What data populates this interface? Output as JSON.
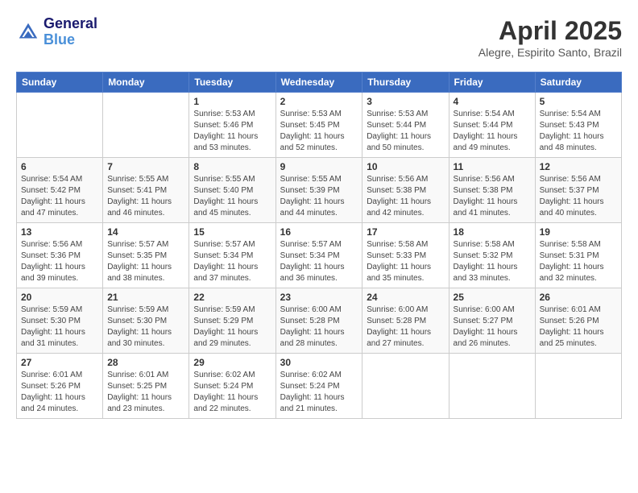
{
  "header": {
    "logo_general": "General",
    "logo_blue": "Blue",
    "month_year": "April 2025",
    "location": "Alegre, Espirito Santo, Brazil"
  },
  "columns": [
    "Sunday",
    "Monday",
    "Tuesday",
    "Wednesday",
    "Thursday",
    "Friday",
    "Saturday"
  ],
  "weeks": [
    {
      "days": [
        {
          "num": "",
          "info": ""
        },
        {
          "num": "",
          "info": ""
        },
        {
          "num": "1",
          "info": "Sunrise: 5:53 AM\nSunset: 5:46 PM\nDaylight: 11 hours\nand 53 minutes."
        },
        {
          "num": "2",
          "info": "Sunrise: 5:53 AM\nSunset: 5:45 PM\nDaylight: 11 hours\nand 52 minutes."
        },
        {
          "num": "3",
          "info": "Sunrise: 5:53 AM\nSunset: 5:44 PM\nDaylight: 11 hours\nand 50 minutes."
        },
        {
          "num": "4",
          "info": "Sunrise: 5:54 AM\nSunset: 5:44 PM\nDaylight: 11 hours\nand 49 minutes."
        },
        {
          "num": "5",
          "info": "Sunrise: 5:54 AM\nSunset: 5:43 PM\nDaylight: 11 hours\nand 48 minutes."
        }
      ]
    },
    {
      "days": [
        {
          "num": "6",
          "info": "Sunrise: 5:54 AM\nSunset: 5:42 PM\nDaylight: 11 hours\nand 47 minutes."
        },
        {
          "num": "7",
          "info": "Sunrise: 5:55 AM\nSunset: 5:41 PM\nDaylight: 11 hours\nand 46 minutes."
        },
        {
          "num": "8",
          "info": "Sunrise: 5:55 AM\nSunset: 5:40 PM\nDaylight: 11 hours\nand 45 minutes."
        },
        {
          "num": "9",
          "info": "Sunrise: 5:55 AM\nSunset: 5:39 PM\nDaylight: 11 hours\nand 44 minutes."
        },
        {
          "num": "10",
          "info": "Sunrise: 5:56 AM\nSunset: 5:38 PM\nDaylight: 11 hours\nand 42 minutes."
        },
        {
          "num": "11",
          "info": "Sunrise: 5:56 AM\nSunset: 5:38 PM\nDaylight: 11 hours\nand 41 minutes."
        },
        {
          "num": "12",
          "info": "Sunrise: 5:56 AM\nSunset: 5:37 PM\nDaylight: 11 hours\nand 40 minutes."
        }
      ]
    },
    {
      "days": [
        {
          "num": "13",
          "info": "Sunrise: 5:56 AM\nSunset: 5:36 PM\nDaylight: 11 hours\nand 39 minutes."
        },
        {
          "num": "14",
          "info": "Sunrise: 5:57 AM\nSunset: 5:35 PM\nDaylight: 11 hours\nand 38 minutes."
        },
        {
          "num": "15",
          "info": "Sunrise: 5:57 AM\nSunset: 5:34 PM\nDaylight: 11 hours\nand 37 minutes."
        },
        {
          "num": "16",
          "info": "Sunrise: 5:57 AM\nSunset: 5:34 PM\nDaylight: 11 hours\nand 36 minutes."
        },
        {
          "num": "17",
          "info": "Sunrise: 5:58 AM\nSunset: 5:33 PM\nDaylight: 11 hours\nand 35 minutes."
        },
        {
          "num": "18",
          "info": "Sunrise: 5:58 AM\nSunset: 5:32 PM\nDaylight: 11 hours\nand 33 minutes."
        },
        {
          "num": "19",
          "info": "Sunrise: 5:58 AM\nSunset: 5:31 PM\nDaylight: 11 hours\nand 32 minutes."
        }
      ]
    },
    {
      "days": [
        {
          "num": "20",
          "info": "Sunrise: 5:59 AM\nSunset: 5:30 PM\nDaylight: 11 hours\nand 31 minutes."
        },
        {
          "num": "21",
          "info": "Sunrise: 5:59 AM\nSunset: 5:30 PM\nDaylight: 11 hours\nand 30 minutes."
        },
        {
          "num": "22",
          "info": "Sunrise: 5:59 AM\nSunset: 5:29 PM\nDaylight: 11 hours\nand 29 minutes."
        },
        {
          "num": "23",
          "info": "Sunrise: 6:00 AM\nSunset: 5:28 PM\nDaylight: 11 hours\nand 28 minutes."
        },
        {
          "num": "24",
          "info": "Sunrise: 6:00 AM\nSunset: 5:28 PM\nDaylight: 11 hours\nand 27 minutes."
        },
        {
          "num": "25",
          "info": "Sunrise: 6:00 AM\nSunset: 5:27 PM\nDaylight: 11 hours\nand 26 minutes."
        },
        {
          "num": "26",
          "info": "Sunrise: 6:01 AM\nSunset: 5:26 PM\nDaylight: 11 hours\nand 25 minutes."
        }
      ]
    },
    {
      "days": [
        {
          "num": "27",
          "info": "Sunrise: 6:01 AM\nSunset: 5:26 PM\nDaylight: 11 hours\nand 24 minutes."
        },
        {
          "num": "28",
          "info": "Sunrise: 6:01 AM\nSunset: 5:25 PM\nDaylight: 11 hours\nand 23 minutes."
        },
        {
          "num": "29",
          "info": "Sunrise: 6:02 AM\nSunset: 5:24 PM\nDaylight: 11 hours\nand 22 minutes."
        },
        {
          "num": "30",
          "info": "Sunrise: 6:02 AM\nSunset: 5:24 PM\nDaylight: 11 hours\nand 21 minutes."
        },
        {
          "num": "",
          "info": ""
        },
        {
          "num": "",
          "info": ""
        },
        {
          "num": "",
          "info": ""
        }
      ]
    }
  ]
}
